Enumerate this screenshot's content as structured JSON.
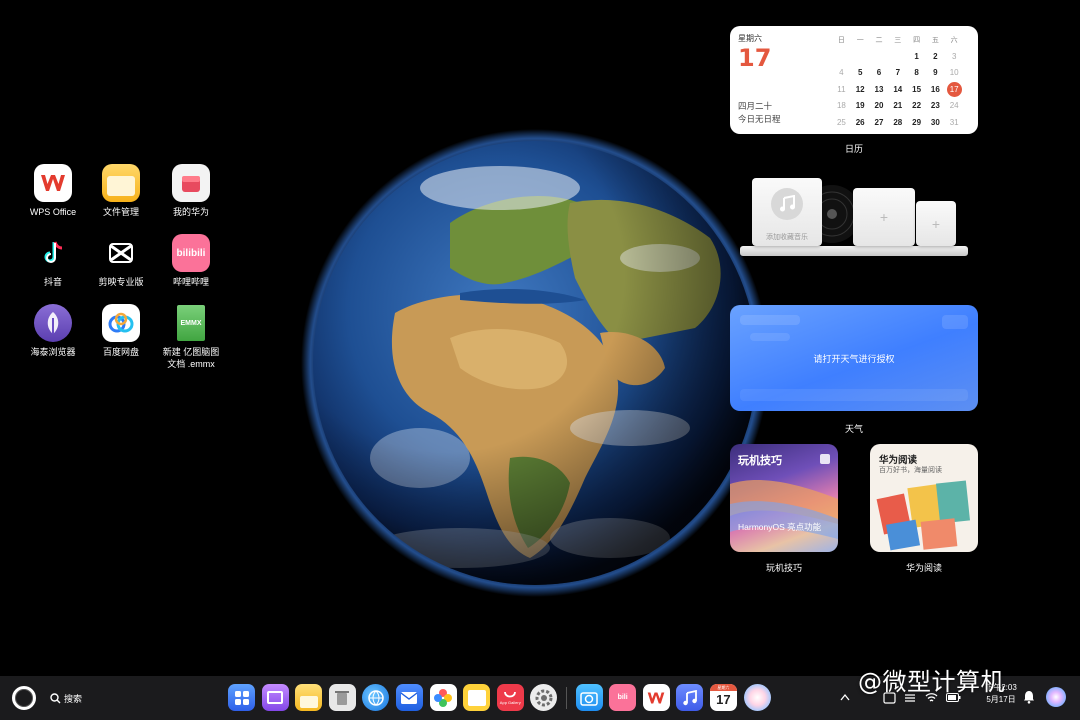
{
  "desktop": {
    "icons": [
      {
        "label": "WPS Office",
        "icon": "wps-office-icon"
      },
      {
        "label": "文件管理",
        "icon": "file-manager-icon"
      },
      {
        "label": "我的华为",
        "icon": "my-huawei-icon"
      },
      {
        "label": "抖音",
        "icon": "douyin-icon"
      },
      {
        "label": "剪映专业版",
        "icon": "capcut-icon"
      },
      {
        "label": "哔哩哔哩",
        "icon": "bilibili-icon"
      },
      {
        "label": "海泰浏览器",
        "icon": "browser-icon"
      },
      {
        "label": "百度网盘",
        "icon": "baidu-netdisk-icon"
      },
      {
        "label": "新建 亿图脑图\n文档 .emmx",
        "icon": "emmx-file-icon",
        "badge": "EMMX"
      }
    ]
  },
  "calendar_widget": {
    "weekday": "星期六",
    "day": "17",
    "lunar": "四月二十",
    "schedule": "今日无日程",
    "headers": [
      "日",
      "一",
      "二",
      "三",
      "四",
      "五",
      "六"
    ],
    "weeks": [
      [
        "",
        "",
        "",
        "",
        "1",
        "2",
        "3"
      ],
      [
        "4",
        "5",
        "6",
        "7",
        "8",
        "9",
        "10"
      ],
      [
        "11",
        "12",
        "13",
        "14",
        "15",
        "16",
        "17"
      ],
      [
        "18",
        "19",
        "20",
        "21",
        "22",
        "23",
        "24"
      ],
      [
        "25",
        "26",
        "27",
        "28",
        "29",
        "30",
        "31"
      ]
    ],
    "today": "17",
    "caption": "日历"
  },
  "music_widget": {
    "add_label": "添加收藏音乐"
  },
  "weather_widget": {
    "message": "请打开天气进行授权",
    "caption": "天气"
  },
  "tips_widget": {
    "title": "玩机技巧",
    "subtitle": "HarmonyOS 亮点功能",
    "caption": "玩机技巧"
  },
  "reading_widget": {
    "title": "华为阅读",
    "subtitle": "百万好书，海量阅读",
    "caption": "华为阅读"
  },
  "taskbar": {
    "search_label": "搜索",
    "dock_apps": [
      "app-center-icon",
      "multi-window-icon",
      "notes-icon",
      "trash-icon",
      "browser-icon",
      "mail-icon",
      "gallery-icon",
      "memo-icon",
      "app-gallery-icon",
      "settings-icon",
      "camera-icon",
      "bilibili-icon",
      "wps-icon",
      "music-icon",
      "calendar-icon",
      "celia-icon"
    ],
    "app_gallery_label": "App Gallery",
    "calendar_icon_day": "17",
    "calendar_icon_week": "星期六",
    "time": "下午2:03",
    "date": "5月17日"
  },
  "watermark": "@微型计算机"
}
